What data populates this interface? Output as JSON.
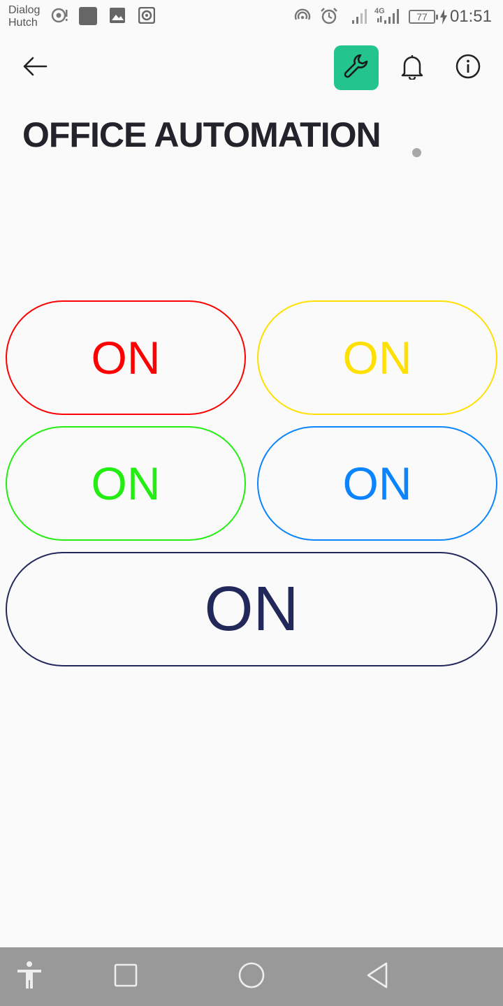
{
  "status_bar": {
    "carrier_line1": "Dialog",
    "carrier_line2": "Hutch",
    "signal_label": "4G",
    "battery": "77",
    "time": "01:51",
    "icons": [
      "hotspot-icon",
      "app-icon",
      "image-icon",
      "radio-icon",
      "wifi-icon",
      "alarm-icon",
      "signal-icon",
      "charging-icon"
    ]
  },
  "toolbar": {
    "icons": [
      "back-arrow-icon",
      "wrench-icon",
      "bell-icon",
      "info-icon"
    ],
    "accent": "#23c48e"
  },
  "page": {
    "title": "OFFICE AUTOMATION",
    "status_dot_color": "#a8a8a8"
  },
  "buttons": [
    {
      "label": "ON",
      "color": "#ff0000"
    },
    {
      "label": "ON",
      "color": "#ffe000"
    },
    {
      "label": "ON",
      "color": "#22ee11"
    },
    {
      "label": "ON",
      "color": "#0a84ff"
    },
    {
      "label": "ON",
      "color": "#23285a"
    }
  ],
  "nav_bar": {
    "icons": [
      "accessibility-icon",
      "recents-square-icon",
      "home-circle-icon",
      "back-triangle-icon"
    ],
    "color": "#999999"
  }
}
